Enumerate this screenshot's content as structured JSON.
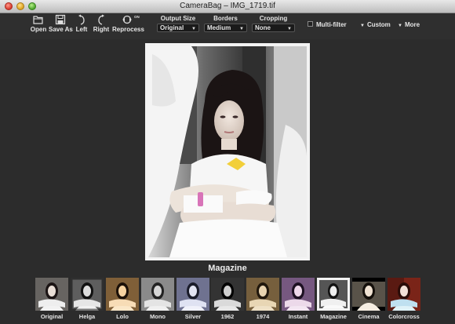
{
  "window": {
    "title": "CameraBag – IMG_1719.tif"
  },
  "toolbar": {
    "open_label": "Open",
    "saveas_label": "Save As",
    "left_label": "Left",
    "right_label": "Right",
    "reprocess_label": "Reprocess",
    "reprocess_badge": "ON",
    "output_size": {
      "label": "Output Size",
      "value": "Original"
    },
    "borders": {
      "label": "Borders",
      "value": "Medium"
    },
    "cropping": {
      "label": "Cropping",
      "value": "None"
    },
    "multifilter_label": "Multi-filter",
    "custom_label": "Custom",
    "more_label": "More"
  },
  "viewer": {
    "filter_name": "Magazine"
  },
  "filters": [
    {
      "label": "Original",
      "tint": "#d9d2c8"
    },
    {
      "label": "Helga",
      "tint": "#bfbfbf"
    },
    {
      "label": "Lolo",
      "tint": "#e8b06a"
    },
    {
      "label": "Mono",
      "tint": "#b0b0b0"
    },
    {
      "label": "Silver",
      "tint": "#c7cbe0"
    },
    {
      "label": "1962",
      "tint": "#9a9a9a"
    },
    {
      "label": "1974",
      "tint": "#c9a770"
    },
    {
      "label": "Instant",
      "tint": "#c8b0d0"
    },
    {
      "label": "Magazine",
      "tint": "#e6e6e6"
    },
    {
      "label": "Cinema",
      "tint": "#e9e0d0"
    },
    {
      "label": "Colorcross",
      "tint": "#bfe0f0"
    }
  ]
}
